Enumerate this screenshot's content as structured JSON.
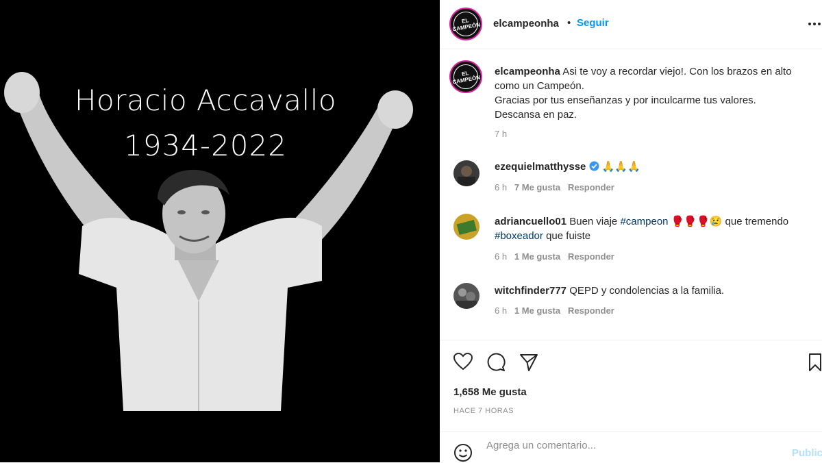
{
  "post_image": {
    "name": "Horacio Accavallo",
    "years": "1934-2022"
  },
  "header": {
    "avatar_text": "EL CAMPEÓN",
    "username": "elcampeonha",
    "separator": "•",
    "follow_label": "Seguir"
  },
  "caption": {
    "username": "elcampeonha",
    "line1": "Asi te voy a recordar viejo!. Con los brazos en alto",
    "line2": "como un Campeón.",
    "line3": "Gracias por tus enseñanzas y por inculcarme tus valores.",
    "line4": "Descansa en paz.",
    "time": "7 h"
  },
  "comments": [
    {
      "username": "ezequielmatthysse",
      "verified": true,
      "text": "🙏🙏🙏",
      "time": "6 h",
      "likes": "7 Me gusta",
      "reply": "Responder"
    },
    {
      "username": "adriancuello01",
      "text_pre": "Buen viaje",
      "hashtag1": "#campeon",
      "text_mid": "🥊🥊🥊😢 que tremendo",
      "hashtag2": "#boxeador",
      "text_post": "que fuiste",
      "time": "6 h",
      "likes": "1 Me gusta",
      "reply": "Responder"
    },
    {
      "username": "witchfinder777",
      "text": "QEPD y condolencias a la familia.",
      "time": "6 h",
      "likes": "1 Me gusta",
      "reply": "Responder"
    }
  ],
  "stats": {
    "likes": "1,658 Me gusta",
    "time_ago": "HACE 7 HORAS"
  },
  "add_comment": {
    "placeholder": "Agrega un comentario...",
    "publish_label": "Publicar"
  },
  "icons": [
    "more-options-icon",
    "heart-icon",
    "comment-icon",
    "share-icon",
    "bookmark-icon",
    "emoji-icon",
    "verified-badge-icon"
  ],
  "colors": {
    "accent": "#0095f6",
    "muted": "#8e8e8e",
    "hashtag": "#00376b",
    "text": "#262626"
  }
}
